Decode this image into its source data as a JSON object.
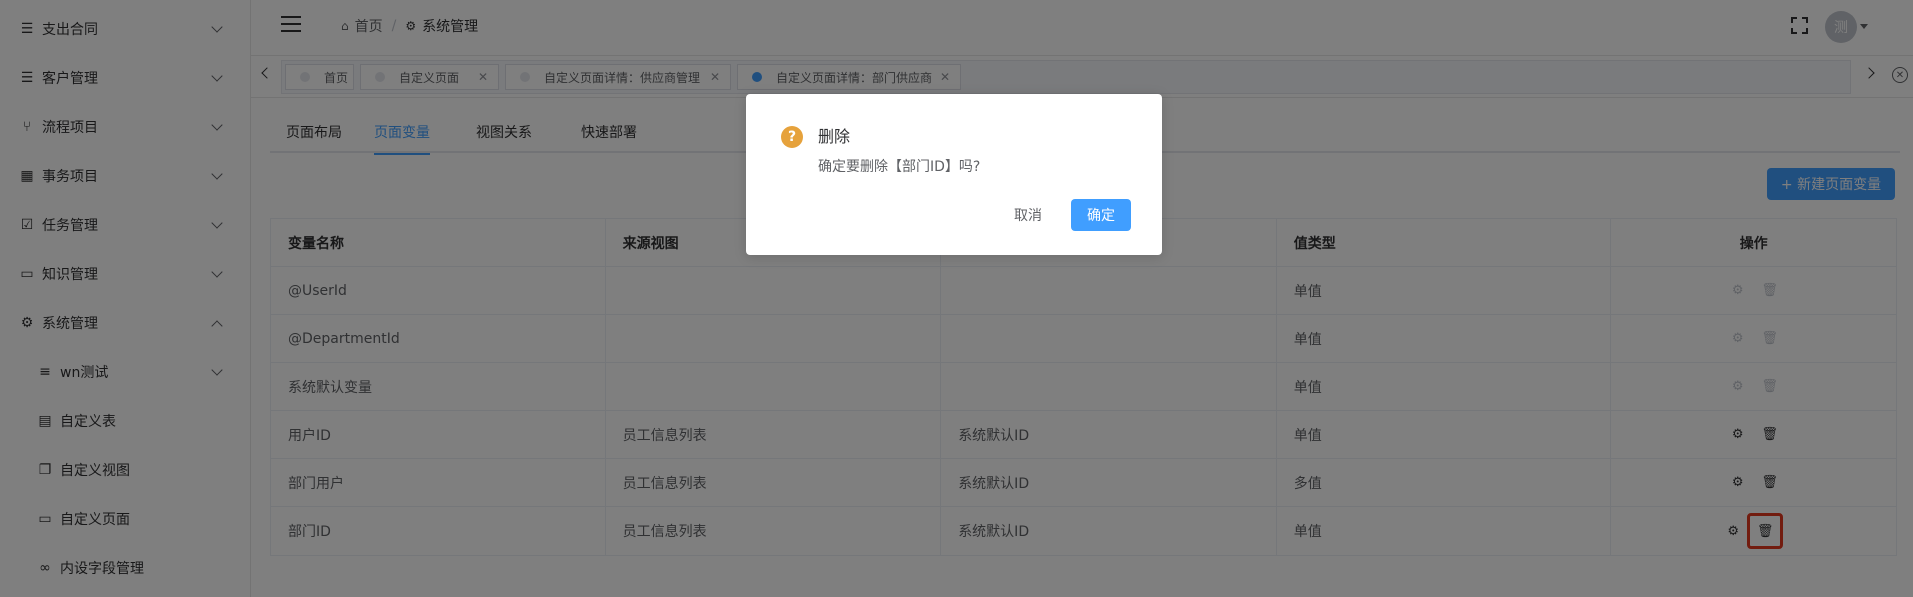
{
  "sidebar": {
    "items": [
      {
        "label": "支出合同",
        "icon": "list-icon",
        "expanded": false
      },
      {
        "label": "客户管理",
        "icon": "list-icon",
        "expanded": false
      },
      {
        "label": "流程项目",
        "icon": "branch-icon",
        "expanded": false
      },
      {
        "label": "事务项目",
        "icon": "grid-icon",
        "expanded": false
      },
      {
        "label": "任务管理",
        "icon": "checkbox-icon",
        "expanded": false
      },
      {
        "label": "知识管理",
        "icon": "book-icon",
        "expanded": false
      },
      {
        "label": "系统管理",
        "icon": "gear-icon",
        "expanded": true
      }
    ],
    "sub_items": [
      {
        "label": "wn测试",
        "icon": "filter-icon",
        "has_children": true
      },
      {
        "label": "自定义表",
        "icon": "document-icon"
      },
      {
        "label": "自定义视图",
        "icon": "copy-icon"
      },
      {
        "label": "自定义页面",
        "icon": "window-icon"
      },
      {
        "label": "内设字段管理",
        "icon": "link-icon"
      }
    ]
  },
  "header": {
    "breadcrumb": [
      {
        "label": "首页",
        "icon": "home-icon"
      },
      {
        "label": "系统管理",
        "icon": "gear-icon"
      }
    ],
    "avatar_text": "测"
  },
  "tabs": [
    {
      "label": "首页",
      "closable": false,
      "active": false
    },
    {
      "label": "自定义页面",
      "closable": true,
      "active": false
    },
    {
      "label": "自定义页面详情：供应商管理",
      "closable": true,
      "active": false
    },
    {
      "label": "自定义页面详情：部门供应商",
      "closable": true,
      "active": true
    }
  ],
  "subtabs": [
    "页面布局",
    "页面变量",
    "视图关系",
    "快速部署"
  ],
  "active_subtab": "页面变量",
  "new_button_label": "+ 新建页面变量",
  "table": {
    "headers": [
      "变量名称",
      "来源视图",
      "",
      "值类型",
      "操作"
    ],
    "rows": [
      {
        "name": "@UserId",
        "source_view": "",
        "field": "",
        "value_type": "单值",
        "ops_enabled": false
      },
      {
        "name": "@DepartmentId",
        "source_view": "",
        "field": "",
        "value_type": "单值",
        "ops_enabled": false
      },
      {
        "name": "系统默认变量",
        "source_view": "",
        "field": "",
        "value_type": "单值",
        "ops_enabled": false
      },
      {
        "name": "用户ID",
        "source_view": "员工信息列表",
        "field": "系统默认ID",
        "value_type": "单值",
        "ops_enabled": true
      },
      {
        "name": "部门用户",
        "source_view": "员工信息列表",
        "field": "系统默认ID",
        "value_type": "多值",
        "ops_enabled": true
      },
      {
        "name": "部门ID",
        "source_view": "员工信息列表",
        "field": "系统默认ID",
        "value_type": "单值",
        "ops_enabled": true
      }
    ]
  },
  "dialog": {
    "icon": "?",
    "title": "删除",
    "message": "确定要删除【部门ID】吗?",
    "cancel_label": "取消",
    "confirm_label": "确定"
  },
  "colors": {
    "primary": "#409eff",
    "warning": "#e6a23c",
    "highlight": "#e5391f"
  }
}
